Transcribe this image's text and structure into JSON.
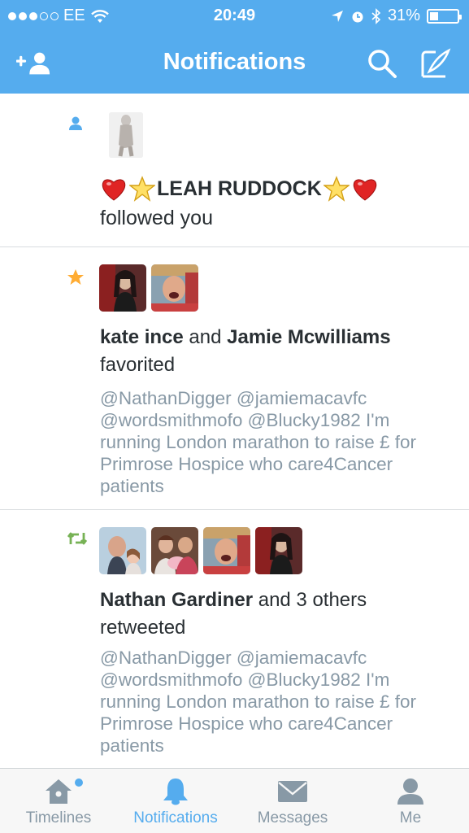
{
  "status_bar": {
    "carrier": "EE",
    "time": "20:49",
    "battery": "31%",
    "signal_icon": "signal-dots-icon",
    "wifi_icon": "wifi-icon",
    "location_icon": "location-arrow-icon",
    "alarm_icon": "alarm-clock-icon",
    "bluetooth_icon": "bluetooth-icon",
    "battery_level": 0.31
  },
  "nav": {
    "title": "Notifications",
    "left_icon": "add-user-icon",
    "search_icon": "search-icon",
    "compose_icon": "compose-icon",
    "bar_color": "#55acee"
  },
  "notifications": [
    {
      "type_icon": "follow-person-icon",
      "name": "❤️⭐LEAH RUDDOCK⭐❤️",
      "action": "followed you",
      "avatars": [
        "leah-ruddock-avatar"
      ]
    },
    {
      "type_icon": "favorite-star-icon",
      "name1": "kate ince",
      "conj": " and ",
      "name2": "Jamie Mcwilliams",
      "action": "favorited",
      "tweet_lines": [
        "@NathanDigger @jamiemacavfc",
        "@wordsmithmofo @Blucky1982 I'm",
        "running London marathon to raise £ for",
        "Primrose Hospice who care4Cancer",
        "patients"
      ],
      "avatars": [
        "kate-ince-avatar",
        "jamie-mcwilliams-avatar"
      ]
    },
    {
      "type_icon": "retweet-icon",
      "name": "Nathan Gardiner",
      "others": " and 3 others",
      "action": "retweeted",
      "tweet_lines": [
        "@NathanDigger @jamiemacavfc",
        "@wordsmithmofo @Blucky1982 I'm",
        "running London marathon to raise £ for",
        "Primrose Hospice who care4Cancer",
        "patients"
      ],
      "avatars": [
        "nathan-gardiner-avatar",
        "family-avatar",
        "jamie-mcwilliams-avatar",
        "kate-ince-avatar"
      ]
    }
  ],
  "tabs": [
    {
      "label": "Timelines",
      "icon": "home-icon",
      "active": false
    },
    {
      "label": "Notifications",
      "icon": "bell-icon",
      "active": true
    },
    {
      "label": "Messages",
      "icon": "envelope-icon",
      "active": false
    },
    {
      "label": "Me",
      "icon": "person-icon",
      "active": false
    }
  ],
  "colors": {
    "accent": "#55acee",
    "favorite": "#ffac33",
    "retweet": "#77b255",
    "muted": "#8899a6"
  }
}
